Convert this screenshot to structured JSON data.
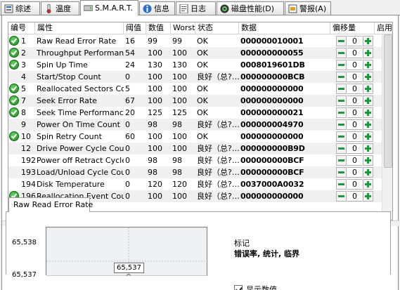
{
  "tabs": [
    {
      "label": "综述",
      "icon": "summary-icon",
      "active": false
    },
    {
      "label": "温度",
      "icon": "thermometer-icon",
      "active": false
    },
    {
      "label": "S.M.A.R.T.",
      "icon": "disk-icon",
      "active": true
    },
    {
      "label": "信息",
      "icon": "info-icon",
      "active": false
    },
    {
      "label": "日志",
      "icon": "log-icon",
      "active": false
    },
    {
      "label": "磁盘性能(D)",
      "icon": "performance-icon",
      "active": false
    },
    {
      "label": "警报(A)",
      "icon": "alert-icon",
      "active": false
    }
  ],
  "table": {
    "columns": [
      "编号",
      "属性",
      "阈值",
      "数值",
      "Worst",
      "状态",
      "数据",
      "偏移量",
      "启用"
    ],
    "rows": [
      {
        "ok": true,
        "id": "1",
        "attr": "Raw Read Error Rate",
        "threshold": "16",
        "value": "99",
        "worst": "99",
        "status": "OK",
        "data": "000000010001",
        "offset": "0"
      },
      {
        "ok": true,
        "id": "2",
        "attr": "Throughput Performance",
        "threshold": "54",
        "value": "100",
        "worst": "100",
        "status": "OK",
        "data": "000000000055",
        "offset": "0"
      },
      {
        "ok": true,
        "id": "3",
        "attr": "Spin Up Time",
        "threshold": "24",
        "value": "130",
        "worst": "130",
        "status": "OK",
        "data": "0008019601DB",
        "offset": "0"
      },
      {
        "ok": false,
        "id": "4",
        "attr": "Start/Stop Count",
        "threshold": "0",
        "value": "100",
        "worst": "100",
        "status": "良好（总?…",
        "data": "000000000BCB",
        "offset": "0"
      },
      {
        "ok": true,
        "id": "5",
        "attr": "Reallocated Sectors Co…",
        "threshold": "5",
        "value": "100",
        "worst": "100",
        "status": "OK",
        "data": "000000000000",
        "offset": "0"
      },
      {
        "ok": true,
        "id": "7",
        "attr": "Seek Error Rate",
        "threshold": "67",
        "value": "100",
        "worst": "100",
        "status": "OK",
        "data": "000000000000",
        "offset": "0"
      },
      {
        "ok": true,
        "id": "8",
        "attr": "Seek Time Performance",
        "threshold": "20",
        "value": "125",
        "worst": "125",
        "status": "OK",
        "data": "000000000021",
        "offset": "0"
      },
      {
        "ok": false,
        "id": "9",
        "attr": "Power On Time Count",
        "threshold": "0",
        "value": "98",
        "worst": "98",
        "status": "良好（总?…",
        "data": "000000004970",
        "offset": "0"
      },
      {
        "ok": true,
        "id": "10",
        "attr": "Spin Retry Count",
        "threshold": "60",
        "value": "100",
        "worst": "100",
        "status": "OK",
        "data": "000000000000",
        "offset": "0"
      },
      {
        "ok": false,
        "id": "12",
        "attr": "Drive Power Cycle Count",
        "threshold": "0",
        "value": "100",
        "worst": "100",
        "status": "良好（总?…",
        "data": "000000000B9D",
        "offset": "0"
      },
      {
        "ok": false,
        "id": "192",
        "attr": "Power off Retract Cycle …",
        "threshold": "0",
        "value": "98",
        "worst": "98",
        "status": "良好（总?…",
        "data": "000000000BCF",
        "offset": "0"
      },
      {
        "ok": false,
        "id": "193",
        "attr": "Load/Unload Cycle Cou…",
        "threshold": "0",
        "value": "98",
        "worst": "98",
        "status": "良好（总?…",
        "data": "000000000BCF",
        "offset": "0"
      },
      {
        "ok": false,
        "id": "194",
        "attr": "Disk Temperature",
        "threshold": "0",
        "value": "120",
        "worst": "120",
        "status": "良好（总?…",
        "data": "0037000A0032",
        "offset": "0"
      },
      {
        "ok": true,
        "id": "196",
        "attr": "Reallocation Event Count",
        "threshold": "0",
        "value": "100",
        "worst": "100",
        "status": "良好（总?…",
        "data": "000000000000",
        "offset": "0"
      }
    ]
  },
  "detail": {
    "tab_label": "Raw Read Error Rate",
    "y_top": "65,538",
    "y_mid": "65,537",
    "tooltip": "65,537",
    "legend_title": "标记",
    "legend_sub": "错误率, 统计, 临界",
    "show_values_label": "显示数值"
  },
  "colors": {
    "ok_green": "#1f8a1f",
    "stepper_green": "#1b9a3c"
  }
}
